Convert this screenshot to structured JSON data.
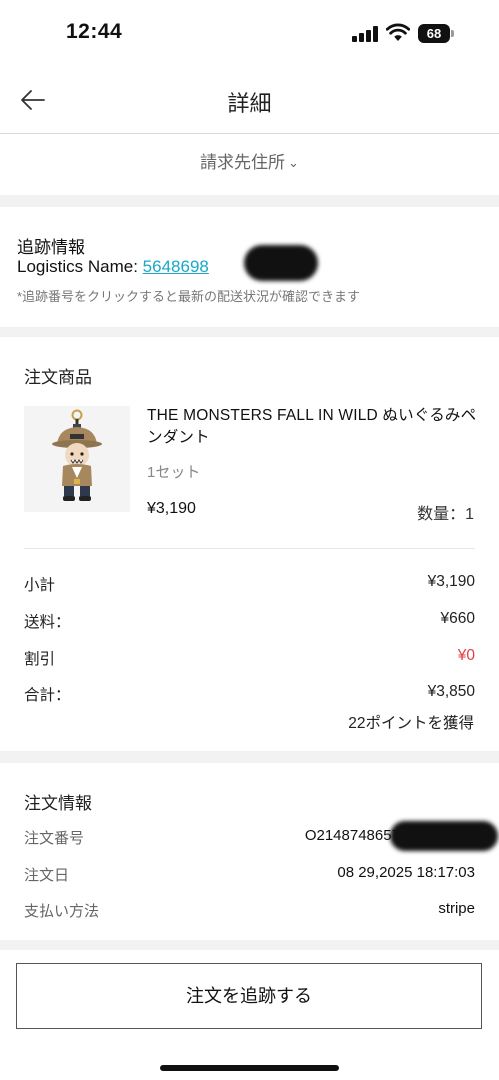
{
  "status_bar": {
    "time": "12:44",
    "battery": "68"
  },
  "nav": {
    "title": "詳細"
  },
  "billing": {
    "label": "請求先住所"
  },
  "tracking": {
    "title": "追跡情報",
    "logistics_label": "Logistics Name: ",
    "tracking_number": "5648698",
    "note": "*追跡番号をクリックすると最新の配送状況が確認できます"
  },
  "products": {
    "title": "注文商品",
    "items": [
      {
        "name": "THE MONSTERS FALL IN WILD ぬいぐるみペンダント",
        "set": "1セット",
        "price": "¥3,190",
        "quantity": "数量：1"
      }
    ],
    "summary": [
      {
        "label": "小計",
        "value": "¥3,190"
      },
      {
        "label": "送料：",
        "value": "¥660"
      },
      {
        "label": "割引",
        "value": "¥0"
      },
      {
        "label": "合計：",
        "value": "¥3,850"
      }
    ],
    "points": "22ポイントを獲得"
  },
  "order_info": {
    "title": "注文情報",
    "rows": [
      {
        "label": "注文番号",
        "value": "O2148748657587308498"
      },
      {
        "label": "注文日",
        "value": "08 29,2025 18:17:03"
      },
      {
        "label": "支払い方法",
        "value": "stripe"
      }
    ]
  },
  "actions": {
    "track_label": "注文を追跡する"
  },
  "colors": {
    "link": "#1aa7c9",
    "discount": "#e0404a",
    "separator": "#f2f2f2"
  }
}
